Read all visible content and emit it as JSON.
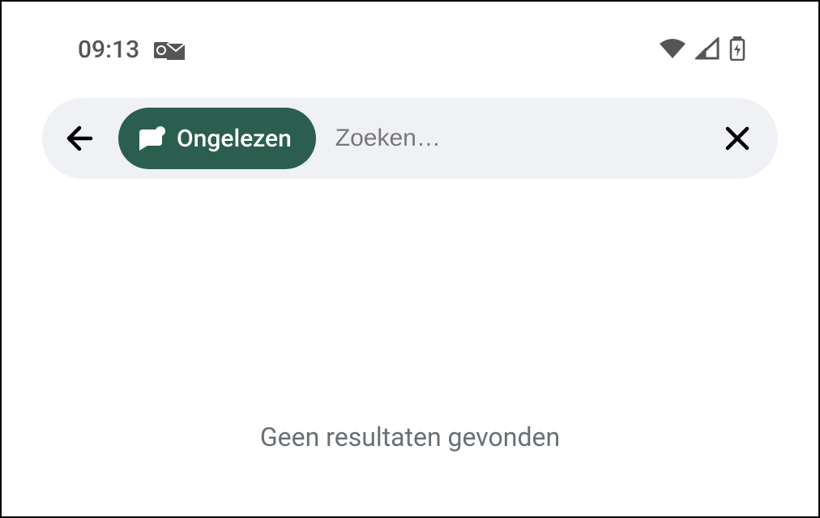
{
  "statusBar": {
    "time": "09:13"
  },
  "searchBar": {
    "placeholder": "Zoeken…",
    "filterChip": {
      "label": "Ongelezen"
    }
  },
  "main": {
    "noResults": "Geen resultaten gevonden"
  }
}
